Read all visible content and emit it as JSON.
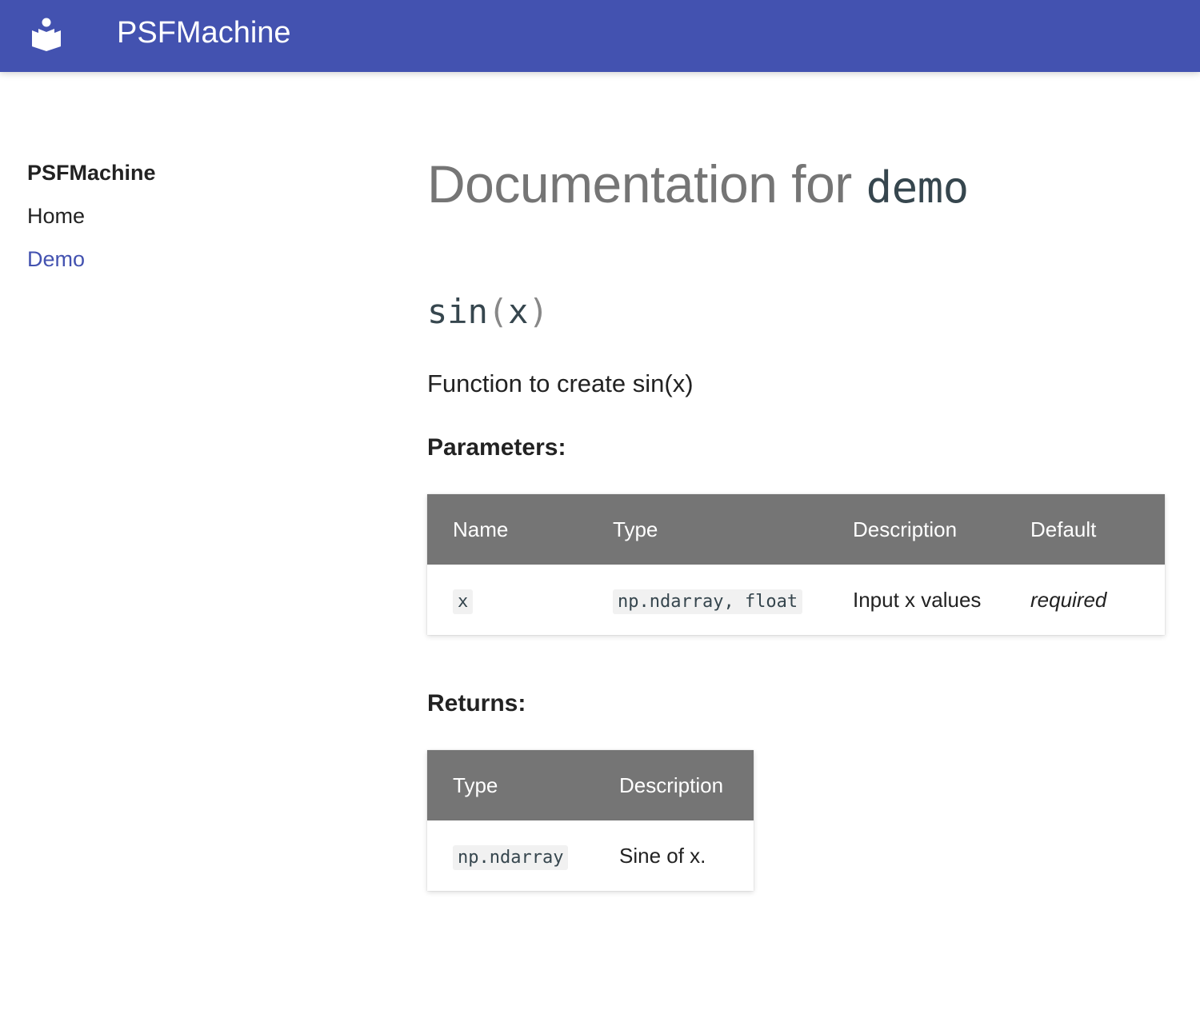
{
  "header": {
    "site_title": "PSFMachine",
    "logo_icon": "book-reader-icon",
    "background_color": "#4352b0"
  },
  "sidebar": {
    "title": "PSFMachine",
    "items": [
      {
        "label": "Home",
        "active": false
      },
      {
        "label": "Demo",
        "active": true
      }
    ],
    "active_color": "#4352b0"
  },
  "main": {
    "title_prefix": "Documentation for",
    "title_module": "demo",
    "function": {
      "name": "sin",
      "open_paren": "(",
      "arg": "x",
      "close_paren": ")",
      "description": "Function to create sin(x)"
    },
    "parameters": {
      "heading": "Parameters:",
      "columns": [
        "Name",
        "Type",
        "Description",
        "Default"
      ],
      "rows": [
        {
          "name": "x",
          "type": "np.ndarray, float",
          "description": "Input x values",
          "default": "required"
        }
      ]
    },
    "returns": {
      "heading": "Returns:",
      "columns": [
        "Type",
        "Description"
      ],
      "rows": [
        {
          "type": "np.ndarray",
          "description": "Sine of x."
        }
      ]
    },
    "table_header_color": "#757575"
  }
}
